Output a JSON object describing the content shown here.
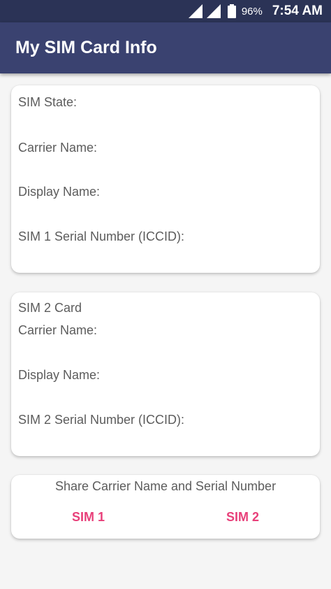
{
  "status_bar": {
    "battery_percent": "96%",
    "time": "7:54 AM"
  },
  "app_bar": {
    "title": "My SIM Card Info"
  },
  "sim1_card": {
    "state_label": "SIM State:",
    "carrier_label": "Carrier Name:",
    "display_label": "Display Name:",
    "serial_label": "SIM 1 Serial Number (ICCID):"
  },
  "sim2_card": {
    "heading": "SIM 2 Card",
    "carrier_label": "Carrier Name:",
    "display_label": "Display Name:",
    "serial_label": "SIM 2 Serial Number (ICCID):"
  },
  "share_card": {
    "title": "Share Carrier Name and Serial Number",
    "sim1_button": "SIM 1",
    "sim2_button": "SIM 2"
  },
  "colors": {
    "status_bar": "#2b3356",
    "app_bar": "#3a4270",
    "accent": "#e8407a",
    "text": "#5c5c5c"
  }
}
